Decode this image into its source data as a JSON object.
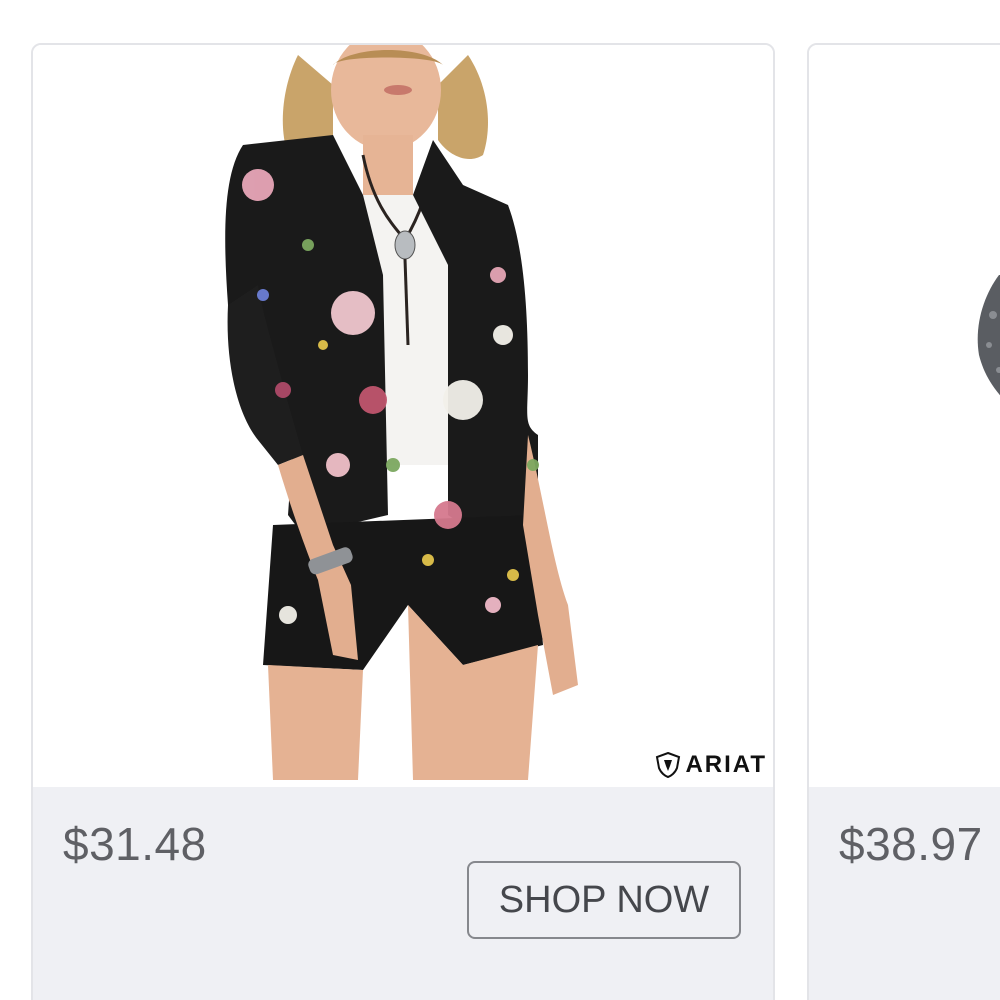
{
  "products": [
    {
      "price": "$31.48",
      "cta_label": "SHOP NOW",
      "brand": "ARIAT",
      "image_alt": "Woman wearing a black floral print blazer with matching shorts and a white top"
    },
    {
      "price": "$38.97"
    }
  ],
  "colors": {
    "card_border": "#e3e4e8",
    "footer_bg": "#eff0f4",
    "price_text": "#5f6065",
    "button_border": "#86888d",
    "button_text": "#45474c"
  },
  "icons": {
    "brand_mark": "horse-head-shield-icon"
  }
}
